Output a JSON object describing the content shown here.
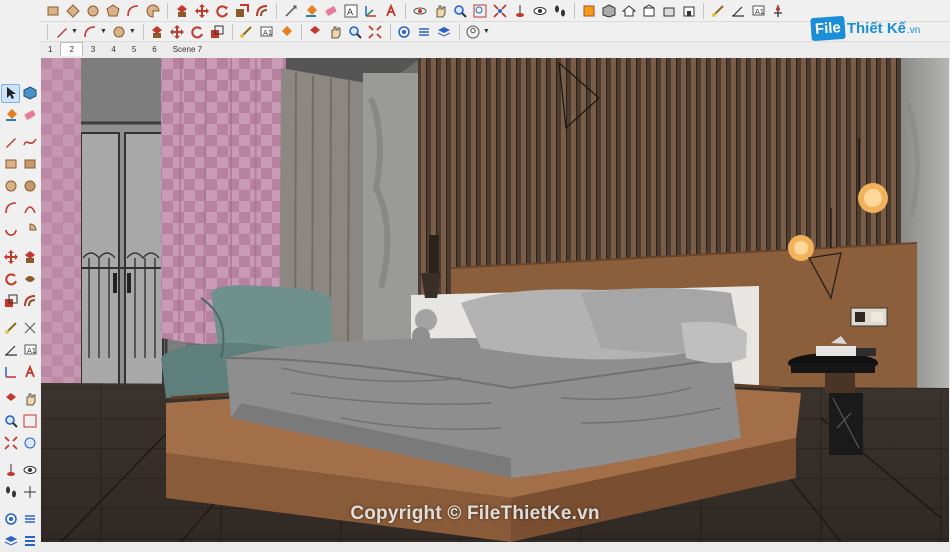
{
  "logo": {
    "file": "File",
    "brand": "Thiết Kế",
    "tld": ".vn"
  },
  "scene_tabs": [
    "1",
    "2",
    "3",
    "4",
    "5",
    "6",
    "Scene 7"
  ],
  "active_tab": "2",
  "watermark": "Copyright © FileThietKe.vn",
  "toolbar_top": [
    "pencil-icon",
    "freehand-icon",
    "rectangle-icon",
    "rotated-rectangle-icon",
    "circle-icon",
    "polygon-icon",
    "arc-icon",
    "pie-icon",
    "push-pull-icon",
    "move-icon",
    "rotate-icon",
    "follow-me-icon",
    "offset-icon",
    "scale-icon",
    "tape-measure-icon",
    "dimension-icon",
    "protractor-icon",
    "text-icon",
    "axes-icon",
    "3d-text-icon",
    "paint-bucket-icon",
    "eraser-icon",
    "orbit-icon",
    "pan-icon",
    "zoom-icon",
    "zoom-window-icon",
    "zoom-extents-icon",
    "position-camera-icon",
    "look-around-icon",
    "walk-icon",
    "section-plane-icon",
    "iso-view-icon",
    "top-view-icon",
    "front-view-icon",
    "right-view-icon",
    "back-view-icon",
    "left-view-icon",
    "tape-icon",
    "dimension2-icon",
    "protractor2-icon",
    "text2-icon",
    "axes2-icon",
    "3dtext2-icon"
  ],
  "colors": {
    "accent": "#1a8fd8",
    "tab_active_bg": "#ffffff",
    "toolbar_bg": "#f0f0f0"
  }
}
